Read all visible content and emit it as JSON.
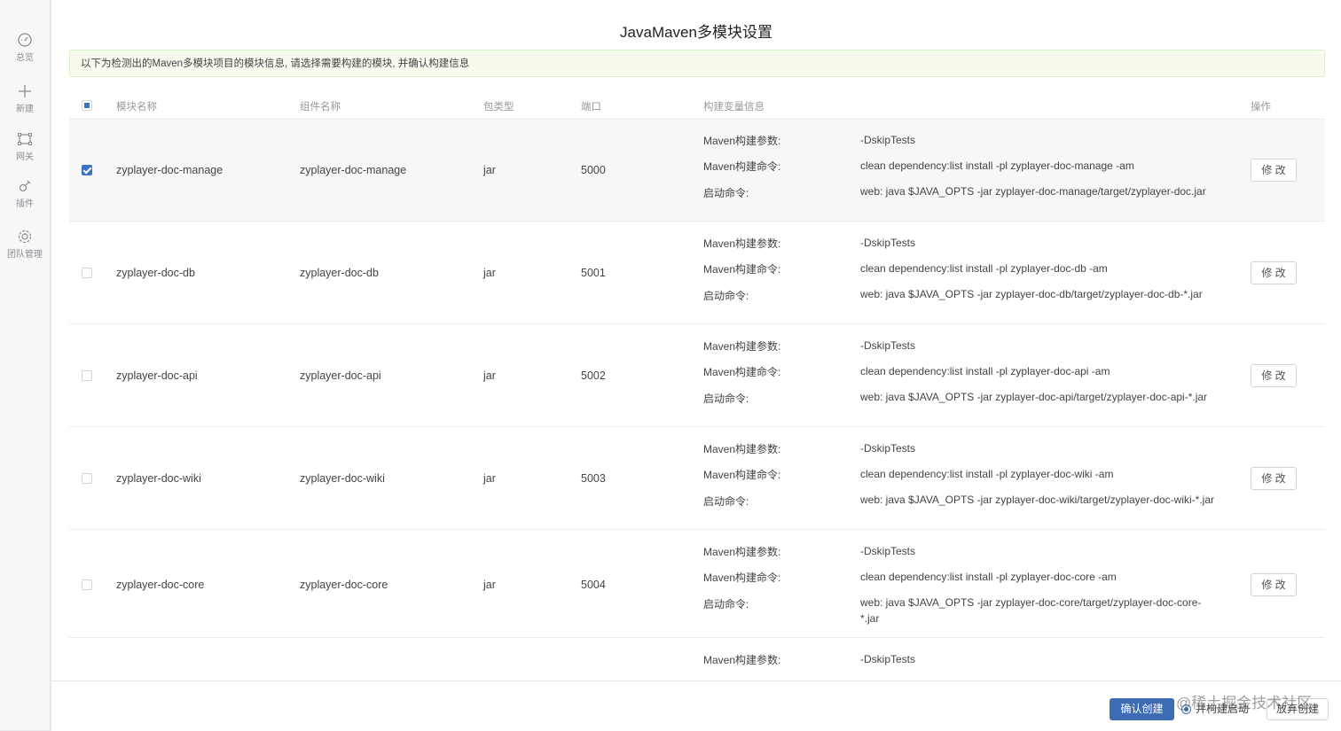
{
  "sidebar": {
    "items": [
      {
        "label": "总览",
        "icon": "dashboard-icon"
      },
      {
        "label": "新建",
        "icon": "plus-icon"
      },
      {
        "label": "网关",
        "icon": "gateway-icon"
      },
      {
        "label": "插件",
        "icon": "plugin-icon"
      },
      {
        "label": "团队管理",
        "icon": "gear-icon"
      }
    ]
  },
  "dialog": {
    "title": "JavaMaven多模块设置",
    "notice": "以下为检测出的Maven多模块项目的模块信息, 请选择需要构建的模块, 并确认构建信息"
  },
  "table": {
    "headers": {
      "module": "模块名称",
      "component": "组件名称",
      "package": "包类型",
      "port": "端口",
      "build": "构建变量信息",
      "action": "操作"
    },
    "labels": {
      "params": "Maven构建参数:",
      "command": "Maven构建命令:",
      "start": "启动命令:"
    },
    "edit_label": "修 改",
    "rows": [
      {
        "module": "zyplayer-doc-manage",
        "component": "zyplayer-doc-manage",
        "package": "jar",
        "port": "5000",
        "checked": true,
        "params": "-DskipTests",
        "command": "clean dependency:list install -pl zyplayer-doc-manage -am",
        "start": "web: java $JAVA_OPTS -jar zyplayer-doc-manage/target/zyplayer-doc.jar"
      },
      {
        "module": "zyplayer-doc-db",
        "component": "zyplayer-doc-db",
        "package": "jar",
        "port": "5001",
        "checked": false,
        "params": "-DskipTests",
        "command": "clean dependency:list install -pl zyplayer-doc-db -am",
        "start": "web: java $JAVA_OPTS -jar zyplayer-doc-db/target/zyplayer-doc-db-*.jar"
      },
      {
        "module": "zyplayer-doc-api",
        "component": "zyplayer-doc-api",
        "package": "jar",
        "port": "5002",
        "checked": false,
        "params": "-DskipTests",
        "command": "clean dependency:list install -pl zyplayer-doc-api -am",
        "start": "web: java $JAVA_OPTS -jar zyplayer-doc-api/target/zyplayer-doc-api-*.jar"
      },
      {
        "module": "zyplayer-doc-wiki",
        "component": "zyplayer-doc-wiki",
        "package": "jar",
        "port": "5003",
        "checked": false,
        "params": "-DskipTests",
        "command": "clean dependency:list install -pl zyplayer-doc-wiki -am",
        "start": "web: java $JAVA_OPTS -jar zyplayer-doc-wiki/target/zyplayer-doc-wiki-*.jar"
      },
      {
        "module": "zyplayer-doc-core",
        "component": "zyplayer-doc-core",
        "package": "jar",
        "port": "5004",
        "checked": false,
        "params": "-DskipTests",
        "command": "clean dependency:list install -pl zyplayer-doc-core -am",
        "start": "web: java $JAVA_OPTS -jar zyplayer-doc-core/target/zyplayer-doc-core-\n*.jar"
      }
    ],
    "partial_row": {
      "params": "-DskipTests"
    }
  },
  "footer": {
    "confirm_label": "确认创建",
    "radio_label": "并构建启动",
    "cancel_label": "放弃创建",
    "watermark": "@稀土掘金技术社区"
  },
  "colors": {
    "primary": "#3d6cb5",
    "notice_bg": "#f6fbee",
    "selected_row_bg": "#f7f7f8"
  }
}
